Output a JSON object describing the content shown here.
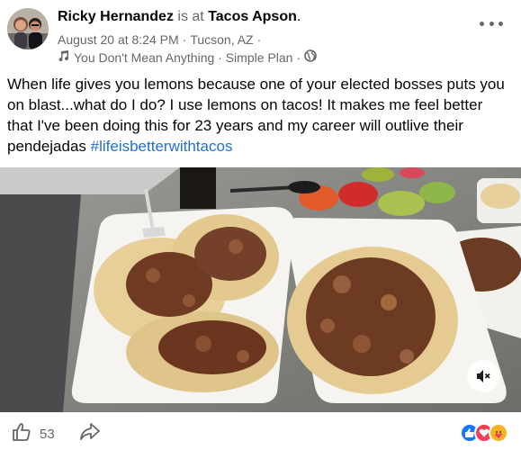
{
  "post": {
    "author_name": "Ricky Hernandez",
    "is_at_text": "is at",
    "place_name": "Tacos Apson",
    "date": "August 20 at 8:24 PM",
    "location": "Tucson, AZ",
    "song": "You Don't Mean Anything · Simple Plan",
    "body_text": "When life gives you lemons because one of your elected bosses puts you on blast...what do I do? I use lemons on tacos! It makes me feel better that I've been doing this for 23 years and my career will outlive their pendejadas ",
    "hashtag": "#lifeisbetterwithtacos"
  },
  "footer": {
    "like_count": "53"
  },
  "icons": {
    "more": "more-options-icon",
    "music": "music-note-icon",
    "privacy": "globe-icon",
    "mute": "speaker-muted-icon",
    "like": "thumbs-up-icon",
    "share": "share-arrow-icon",
    "reactions": [
      "like-reaction-icon",
      "love-reaction-icon",
      "care-reaction-icon"
    ]
  },
  "colors": {
    "link": "#216fdb",
    "muted_text": "#65676b",
    "like_blue": "#1877f2",
    "love_red": "#f33e58",
    "care_yellow": "#f7b125"
  }
}
